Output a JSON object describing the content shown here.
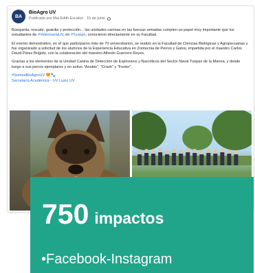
{
  "post": {
    "page_name": "BioAgro UV",
    "meta": "Publicado por Mai Edith Escalon · 15 de junio",
    "avatar_text": "BA",
    "paragraph1_text": "Búsqueda, rescate, guardia y protección... las unidades caninas en las fuerzas armadas cumplen un papel muy importante que los estudiantes de ",
    "paragraph1_link1": "#VeterinariaUV",
    "paragraph1_mid": ", en ",
    "paragraph1_link2": "#Tuxpan",
    "paragraph1_end": ", conocieron directamente en su Facultad.",
    "paragraph2": "El evento demostrativo, en el que participaron más de 70 universitarios, se realizó en la Facultad de Ciencias Biológicas y Agropecuarias y fue organizado a solicitud de los alumnos de la Experiencia Educativa en Zootecnia de Perros y Gatos, impartida por el maestro Carlos David Pérez Brígido, con la colaboración del maestro Alfredo Guerrero Reyes.",
    "paragraph3": "Gracias a los elementos de la Unidad Canina de Detección de Explosivos y Narcóticos del Sector Naval Tuxpan de la Marina, y desde luego a sus perros ejemplares y en activo \"Anubis\", \"Crash\" y \"Foster\".",
    "hashtag": "#SomosBioAgroUV",
    "emoji": "🧡🐾",
    "footer_link": "Secretaría Académica - UV   Luzio UV"
  },
  "overlay": {
    "number": "750",
    "label": "impactos",
    "platforms": "•Facebook-Instagram"
  },
  "colors": {
    "overlay_bg": "#20a58a",
    "link": "#216fdb"
  }
}
